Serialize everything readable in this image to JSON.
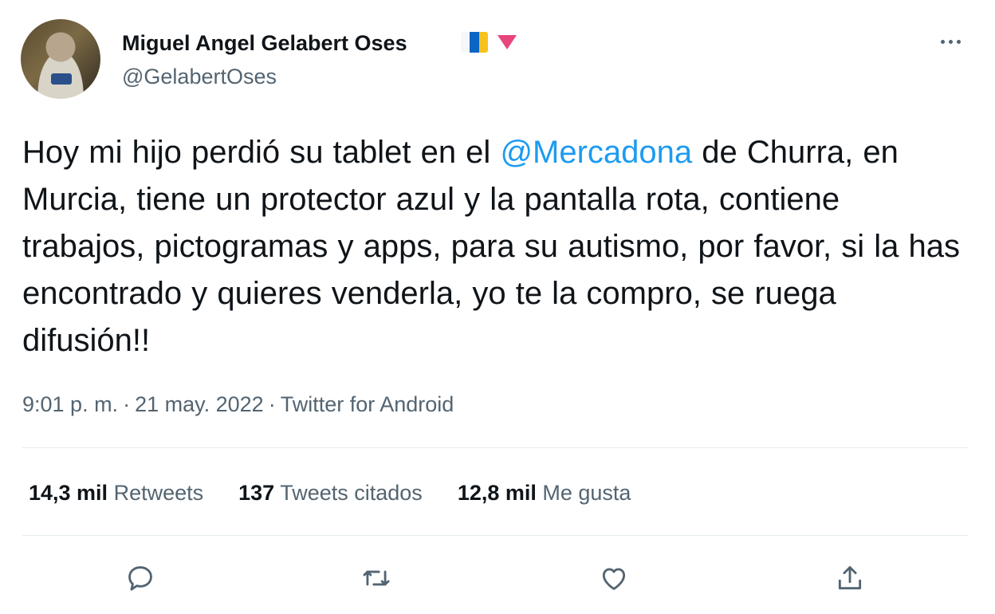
{
  "author": {
    "display_name": "Miguel Angel Gelabert Oses",
    "handle": "@GelabertOses",
    "name_emojis": [
      "canary-islands-flag-icon",
      "red-triangle-icon"
    ]
  },
  "tweet": {
    "text_before_mention": "Hoy mi hijo perdió su tablet en el ",
    "mention": "@Mercadona",
    "text_after_mention": " de Churra, en Murcia, tiene un protector azul y la pantalla rota, contiene trabajos, pictogramas y apps, para su autismo, por favor, si la has encontrado y quieres venderla, yo te la compro, se ruega difusión!!"
  },
  "meta": {
    "time": "9:01 p. m.",
    "separator": "·",
    "date": "21 may. 2022",
    "source": "Twitter for Android"
  },
  "stats": {
    "retweets_count": "14,3 mil",
    "retweets_label": "Retweets",
    "quotes_count": "137",
    "quotes_label": "Tweets citados",
    "likes_count": "12,8 mil",
    "likes_label": "Me gusta"
  },
  "actions": [
    "reply-icon",
    "retweet-icon",
    "like-icon",
    "share-icon"
  ],
  "colors": {
    "link": "#1d9bf0",
    "secondary_text": "#536471",
    "primary_text": "#0f1419",
    "divider": "#e6ecf0"
  }
}
